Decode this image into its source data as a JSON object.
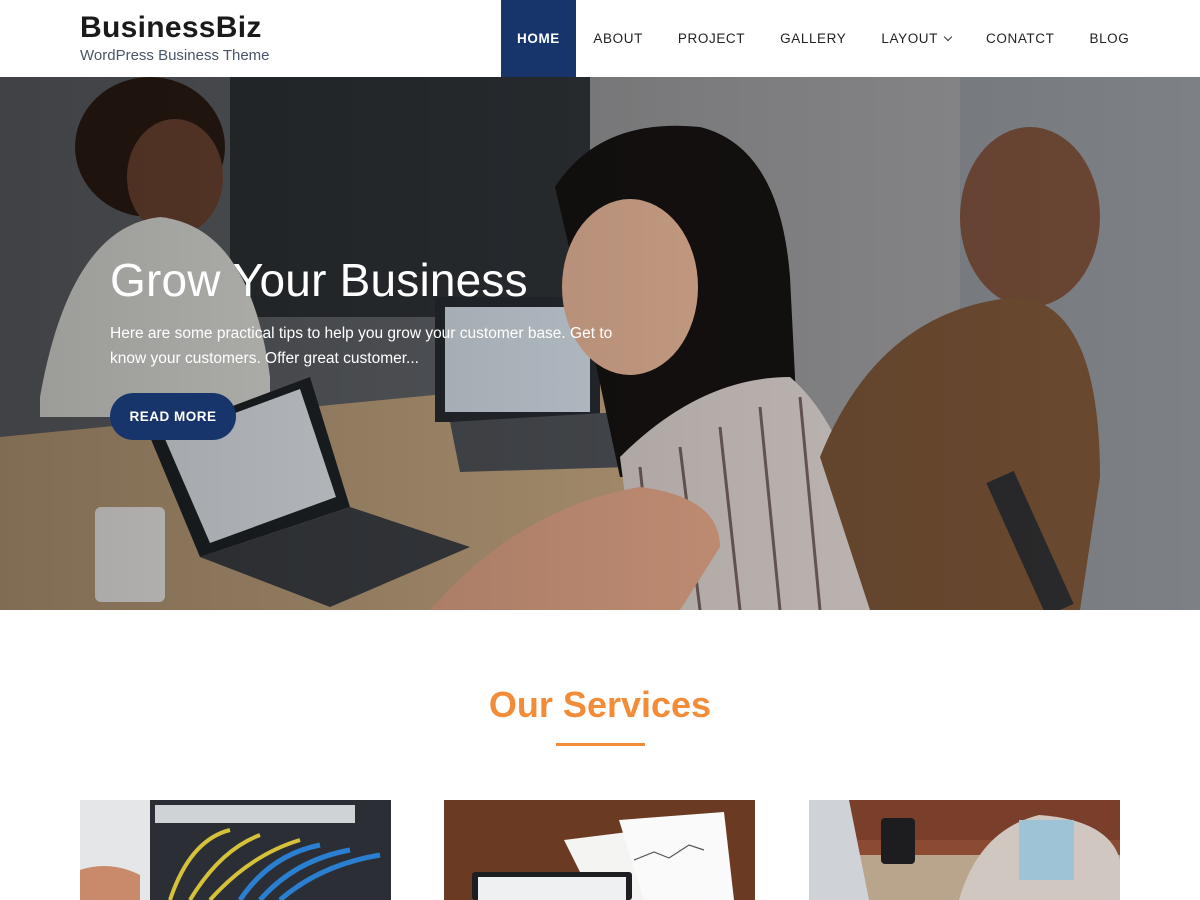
{
  "brand": {
    "title": "BusinessBiz",
    "tagline": "WordPress Business Theme"
  },
  "nav": {
    "items": [
      {
        "label": "HOME",
        "active": true
      },
      {
        "label": "ABOUT"
      },
      {
        "label": "PROJECT"
      },
      {
        "label": "GALLERY"
      },
      {
        "label": "LAYOUT",
        "has_dropdown": true
      },
      {
        "label": "CONATCT"
      },
      {
        "label": "BLOG"
      }
    ]
  },
  "hero": {
    "title": "Grow Your Business",
    "text": "Here are some practical tips to help you grow your customer base. Get to know your customers. Offer great customer...",
    "button_label": "READ MORE"
  },
  "services": {
    "title": "Our Services"
  },
  "colors": {
    "primary": "#17346b",
    "accent": "#f28c38"
  },
  "icons": {
    "dropdown": "chevron-down-icon"
  }
}
